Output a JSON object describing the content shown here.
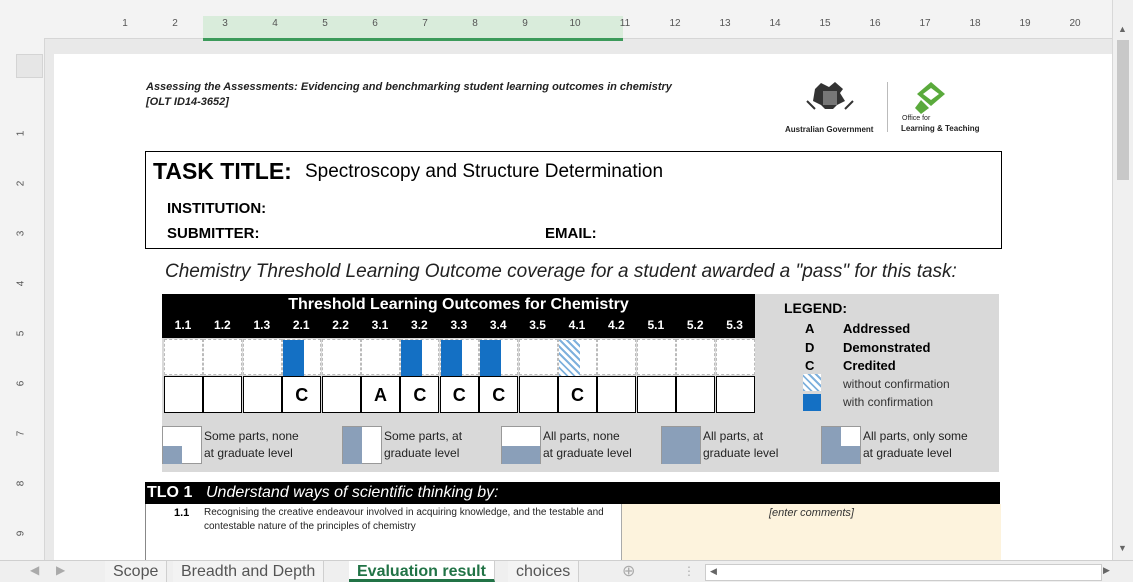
{
  "ruler": {
    "top_numbers": [
      "1",
      "2",
      "3",
      "4",
      "5",
      "6",
      "7",
      "8",
      "9",
      "10",
      "11",
      "12",
      "13",
      "14",
      "15",
      "16",
      "17",
      "18",
      "19",
      "20"
    ],
    "left_numbers": [
      "1",
      "2",
      "3",
      "4",
      "5",
      "6",
      "7",
      "8",
      "9"
    ]
  },
  "header": {
    "line1": "Assessing the Assessments: Evidencing and benchmarking student learning outcomes in chemistry",
    "line2": "[OLT ID14-3652]",
    "gov_logo_caption": "Australian Government",
    "olt_logo_small": "Office for",
    "olt_logo_caption": "Learning & Teaching"
  },
  "task": {
    "title_label": "TASK TITLE:",
    "title_value": "Spectroscopy and Structure Determination",
    "institution_label": "INSTITUTION:",
    "submitter_label": "SUBMITTER:",
    "email_label": "EMAIL:"
  },
  "coverage_heading": "Chemistry Threshold Learning Outcome coverage for a student awarded a \"pass\" for this task:",
  "tlo_table": {
    "title": "Threshold Learning Outcomes for Chemistry",
    "columns": [
      {
        "id": "1.1",
        "fill": "none",
        "mark": ""
      },
      {
        "id": "1.2",
        "fill": "none",
        "mark": ""
      },
      {
        "id": "1.3",
        "fill": "none",
        "mark": ""
      },
      {
        "id": "2.1",
        "fill": "blue",
        "mark": "C"
      },
      {
        "id": "2.2",
        "fill": "none",
        "mark": ""
      },
      {
        "id": "3.1",
        "fill": "none",
        "mark": "A"
      },
      {
        "id": "3.2",
        "fill": "blue",
        "mark": "C"
      },
      {
        "id": "3.3",
        "fill": "blue",
        "mark": "C"
      },
      {
        "id": "3.4",
        "fill": "blue",
        "mark": "C"
      },
      {
        "id": "3.5",
        "fill": "none",
        "mark": ""
      },
      {
        "id": "4.1",
        "fill": "hatch",
        "mark": "C"
      },
      {
        "id": "4.2",
        "fill": "none",
        "mark": ""
      },
      {
        "id": "5.1",
        "fill": "none",
        "mark": ""
      },
      {
        "id": "5.2",
        "fill": "none",
        "mark": ""
      },
      {
        "id": "5.3",
        "fill": "none",
        "mark": ""
      }
    ]
  },
  "legend": {
    "title": "LEGEND:",
    "items": [
      {
        "letter": "A",
        "label": "Addressed"
      },
      {
        "letter": "D",
        "label": "Demonstrated"
      },
      {
        "letter": "C",
        "label": "Credited"
      }
    ],
    "hatch_label": "without confirmation",
    "solid_label": "with confirmation",
    "colors": {
      "solid": "#1470c4",
      "hatch": "#7fb1dd"
    }
  },
  "key": [
    {
      "line1": "Some parts, none",
      "line2": "at graduate level"
    },
    {
      "line1": "Some parts, at",
      "line2": "graduate level"
    },
    {
      "line1": "All parts,  none",
      "line2": "at graduate level"
    },
    {
      "line1": "All parts, at",
      "line2": "graduate level"
    },
    {
      "line1": "All parts, only some",
      "line2": "at graduate level"
    }
  ],
  "tlo1": {
    "id": "TLO 1",
    "description": "Understand ways of scientific thinking by:",
    "row_num": "1.1",
    "row_text": "Recognising the creative endeavour involved in acquiring knowledge, and the testable  and contestable nature of the principles of chemistry",
    "comments_placeholder": "[enter comments]"
  },
  "sheet_tabs": [
    "Scope",
    "Breadth and Depth",
    "Evaluation result",
    "choices"
  ],
  "active_tab": "Evaluation result"
}
